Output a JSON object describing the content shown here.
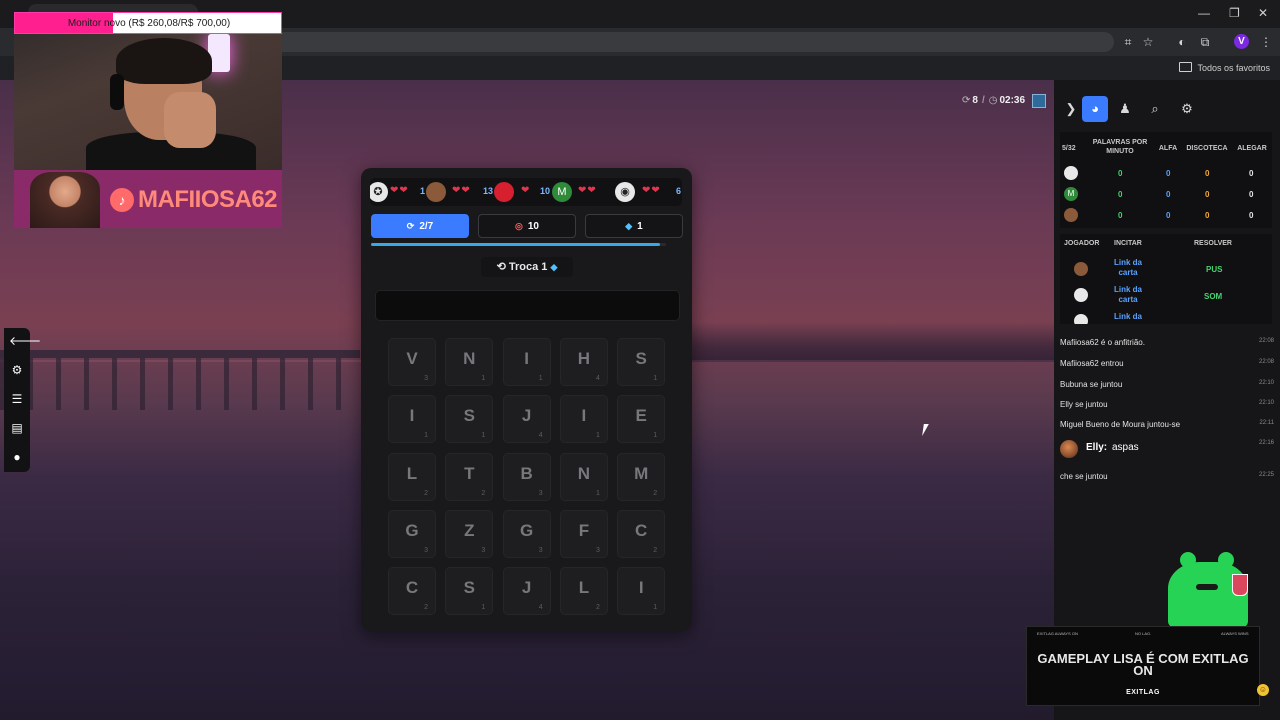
{
  "browser": {
    "bookmarks_label": "Todos os favoritos",
    "profile_letter": "V"
  },
  "overlay": {
    "donation_text": "Monitor novo (R$ 260,08/R$ 700,00)",
    "donation_progress": 0.37,
    "streamer_name": "MAFIIOSA62"
  },
  "game": {
    "round_count": "8",
    "timer": "02:36",
    "players": [
      {
        "hearts": "❤❤",
        "score": "1"
      },
      {
        "hearts": "❤❤",
        "score": "13"
      },
      {
        "hearts": "❤",
        "score": "10"
      },
      {
        "initial": "M",
        "hearts": "❤❤",
        "score": ""
      },
      {
        "hearts": "❤❤",
        "score": "6"
      }
    ],
    "stats": {
      "progress": "2/7",
      "targets": "10",
      "gems": "1"
    },
    "progress_fraction": 0.98,
    "swap_label": "Troca 1",
    "tiles": [
      {
        "l": "V",
        "p": "3"
      },
      {
        "l": "N",
        "p": "1"
      },
      {
        "l": "I",
        "p": "1"
      },
      {
        "l": "H",
        "p": "4"
      },
      {
        "l": "S",
        "p": "1"
      },
      {
        "l": "I",
        "p": "1"
      },
      {
        "l": "S",
        "p": "1"
      },
      {
        "l": "J",
        "p": "4"
      },
      {
        "l": "I",
        "p": "1"
      },
      {
        "l": "E",
        "p": "1"
      },
      {
        "l": "L",
        "p": "2"
      },
      {
        "l": "T",
        "p": "2"
      },
      {
        "l": "B",
        "p": "3"
      },
      {
        "l": "N",
        "p": "1"
      },
      {
        "l": "M",
        "p": "2"
      },
      {
        "l": "G",
        "p": "3"
      },
      {
        "l": "Z",
        "p": "3"
      },
      {
        "l": "G",
        "p": "3"
      },
      {
        "l": "F",
        "p": "3"
      },
      {
        "l": "C",
        "p": "2"
      },
      {
        "l": "C",
        "p": "2"
      },
      {
        "l": "S",
        "p": "1"
      },
      {
        "l": "J",
        "p": "4"
      },
      {
        "l": "L",
        "p": "2"
      },
      {
        "l": "I",
        "p": "1"
      }
    ]
  },
  "sidebar": {
    "stats_headers": {
      "count": "5/32",
      "wpm": "PALAVRAS POR MINUTO",
      "alfa": "ALFA",
      "disco": "DISCOTECA",
      "alegar": "ALEGAR"
    },
    "stats_rows": [
      {
        "avatar": "",
        "wpm": "0",
        "alfa": "0",
        "disco": "0",
        "alegar": "0"
      },
      {
        "avatar": "M",
        "wpm": "0",
        "alfa": "0",
        "disco": "0",
        "alegar": "0"
      },
      {
        "avatar": "",
        "wpm": "0",
        "alfa": "0",
        "disco": "0",
        "alegar": "0"
      }
    ],
    "incite_headers": {
      "player": "JOGADOR",
      "incite": "INCITAR",
      "solve": "RESOLVER"
    },
    "incite_rows": [
      {
        "link": "Link da carta",
        "solve": "PUS"
      },
      {
        "link": "Link da carta",
        "solve": "SOM"
      },
      {
        "link": "Link da",
        "solve": ""
      }
    ]
  },
  "chat": [
    {
      "text": "Mafiiosa62 é o anfitrião.",
      "time": "22:08"
    },
    {
      "text": "Mafiiosa62 entrou",
      "time": "22:08"
    },
    {
      "text": "Bubuna se juntou",
      "time": "22:10"
    },
    {
      "text": "Elly se juntou",
      "time": "22:10"
    },
    {
      "text": "Miguel Bueno de Moura juntou-se",
      "time": "22:11"
    },
    {
      "text": "che se juntou",
      "time": "22:25"
    }
  ],
  "chat_elly": {
    "name": "Elly:",
    "text": "aspas",
    "time": "22:16"
  },
  "ad": {
    "top_left": "EXITLAG ALWAYS ON",
    "top_mid": "NO LAG.",
    "top_right": "ALWAYS WINS",
    "title": "GAMEPLAY LISA É COM EXITLAG ON",
    "brand": "EXITLAG"
  }
}
